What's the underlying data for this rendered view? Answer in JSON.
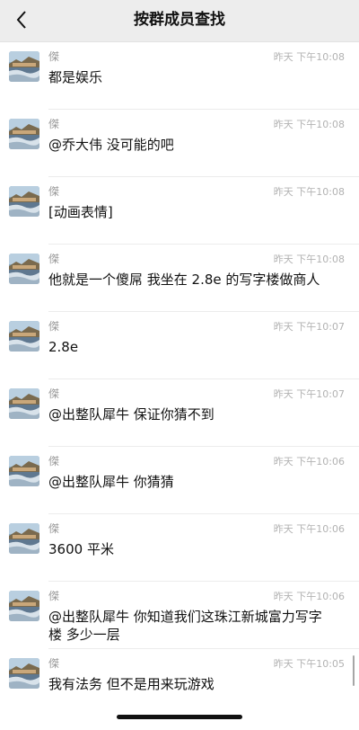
{
  "header": {
    "title": "按群成员查找",
    "back_icon": "chevron-left-icon"
  },
  "messages": [
    {
      "sender": "傑",
      "time": "昨天 下午10:08",
      "text": "都是娱乐"
    },
    {
      "sender": "傑",
      "time": "昨天 下午10:08",
      "text": "@乔大伟 没可能的吧"
    },
    {
      "sender": "傑",
      "time": "昨天 下午10:08",
      "text": "[动画表情]"
    },
    {
      "sender": "傑",
      "time": "昨天 下午10:08",
      "text": "他就是一个傻屌 我坐在 2.8e 的写字楼做商人"
    },
    {
      "sender": "傑",
      "time": "昨天 下午10:07",
      "text": "2.8e"
    },
    {
      "sender": "傑",
      "time": "昨天 下午10:07",
      "text": "@出整队犀牛 保证你猜不到"
    },
    {
      "sender": "傑",
      "time": "昨天 下午10:06",
      "text": "@出整队犀牛 你猜猜"
    },
    {
      "sender": "傑",
      "time": "昨天 下午10:06",
      "text": "3600 平米"
    },
    {
      "sender": "傑",
      "time": "昨天 下午10:06",
      "text": "@出整队犀牛 你知道我们这珠江新城富力写字楼 多少一层"
    },
    {
      "sender": "傑",
      "time": "昨天 下午10:05",
      "text": "我有法务 但不是用来玩游戏"
    }
  ]
}
